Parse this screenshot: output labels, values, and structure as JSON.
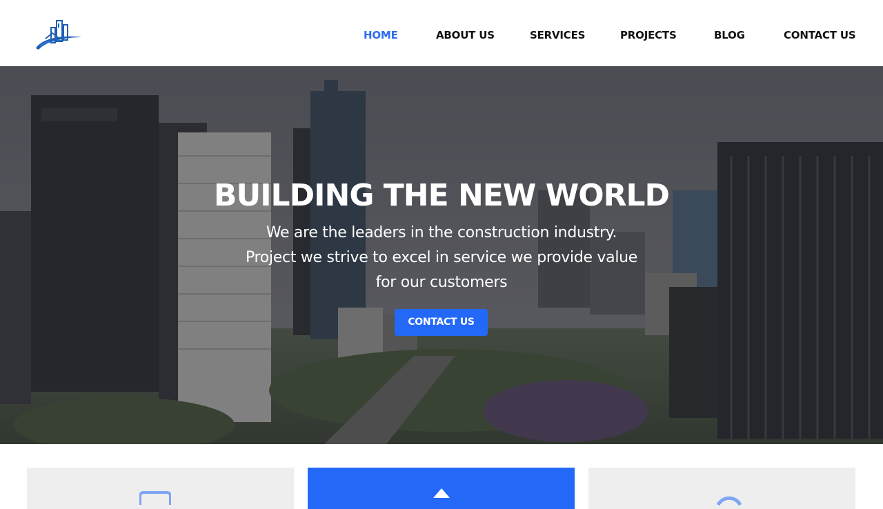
{
  "brand": {
    "logo_icon": "building-logo-icon",
    "accent_color": "#2f6df2"
  },
  "nav": {
    "items": [
      {
        "label": "HOME",
        "active": true
      },
      {
        "label": "ABOUT US",
        "active": false
      },
      {
        "label": "SERVICES",
        "active": false
      },
      {
        "label": "PROJECTS",
        "active": false
      },
      {
        "label": "BLOG",
        "active": false
      },
      {
        "label": "CONTACT US",
        "active": false
      }
    ]
  },
  "hero": {
    "title": "BUILDING THE NEW WORLD",
    "subtitle_lines": [
      "We  are the leaders in the construction industry.",
      "Project we strive to excel in service we provide value",
      "for our customers"
    ],
    "cta_label": "CONTACT US",
    "background": "city-skyline-photo",
    "button_color": "#2368f7"
  },
  "features": {
    "cards": [
      {
        "icon": "document-icon",
        "highlighted": false
      },
      {
        "icon": "arrow-up-icon",
        "highlighted": true
      },
      {
        "icon": "circle-icon",
        "highlighted": false
      }
    ]
  }
}
